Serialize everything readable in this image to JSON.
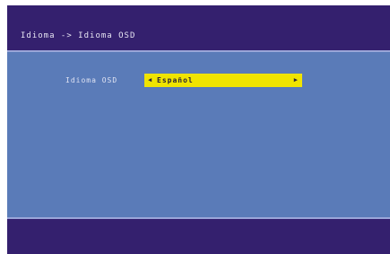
{
  "header": {
    "breadcrumb": "Idioma -> Idioma OSD"
  },
  "settings": {
    "osd_language": {
      "label": "Idioma OSD",
      "value": "Español"
    }
  },
  "icons": {
    "left": "arrow-left-icon",
    "right": "arrow-right-icon"
  },
  "colors": {
    "frame": "#34206e",
    "panel": "#5a7bb8",
    "highlight": "#f0e400"
  }
}
